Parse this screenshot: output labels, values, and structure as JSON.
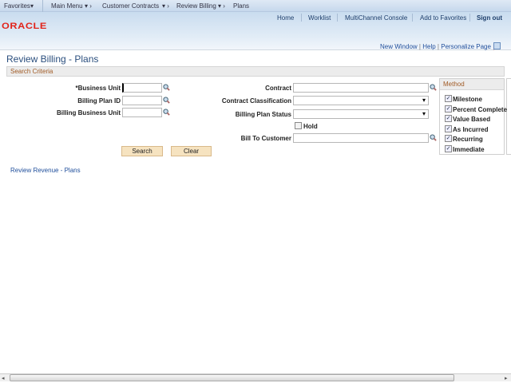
{
  "nav": {
    "favorites": "Favorites",
    "main_menu": "Main Menu",
    "crumbs": [
      "Customer Contracts",
      "Review Billing",
      "Plans"
    ]
  },
  "header": {
    "links": [
      "Home",
      "Worklist",
      "MultiChannel Console",
      "Add to Favorites"
    ],
    "sign_out": "Sign out",
    "logo": "ORACLE"
  },
  "pagebar": {
    "new_window": "New Window",
    "help": "Help",
    "personalize": "Personalize Page"
  },
  "page_title": "Review Billing - Plans",
  "section": "Search Criteria",
  "fields": {
    "business_unit": "*Business Unit",
    "billing_plan_id": "Billing Plan ID",
    "billing_business_unit": "Billing Business Unit",
    "contract": "Contract",
    "contract_classification": "Contract Classification",
    "billing_plan_status": "Billing Plan Status",
    "hold": "Hold",
    "bill_to_customer": "Bill To Customer"
  },
  "buttons": {
    "search": "Search",
    "clear": "Clear"
  },
  "method": {
    "title": "Method",
    "items": [
      {
        "label": "Milestone",
        "checked": true
      },
      {
        "label": "Percent Complete",
        "checked": true
      },
      {
        "label": "Value Based",
        "checked": true
      },
      {
        "label": "As Incurred",
        "checked": true
      },
      {
        "label": "Recurring",
        "checked": true
      },
      {
        "label": "Immediate",
        "checked": true
      }
    ]
  },
  "hold_checked": false,
  "related_link": "Review Revenue - Plans"
}
